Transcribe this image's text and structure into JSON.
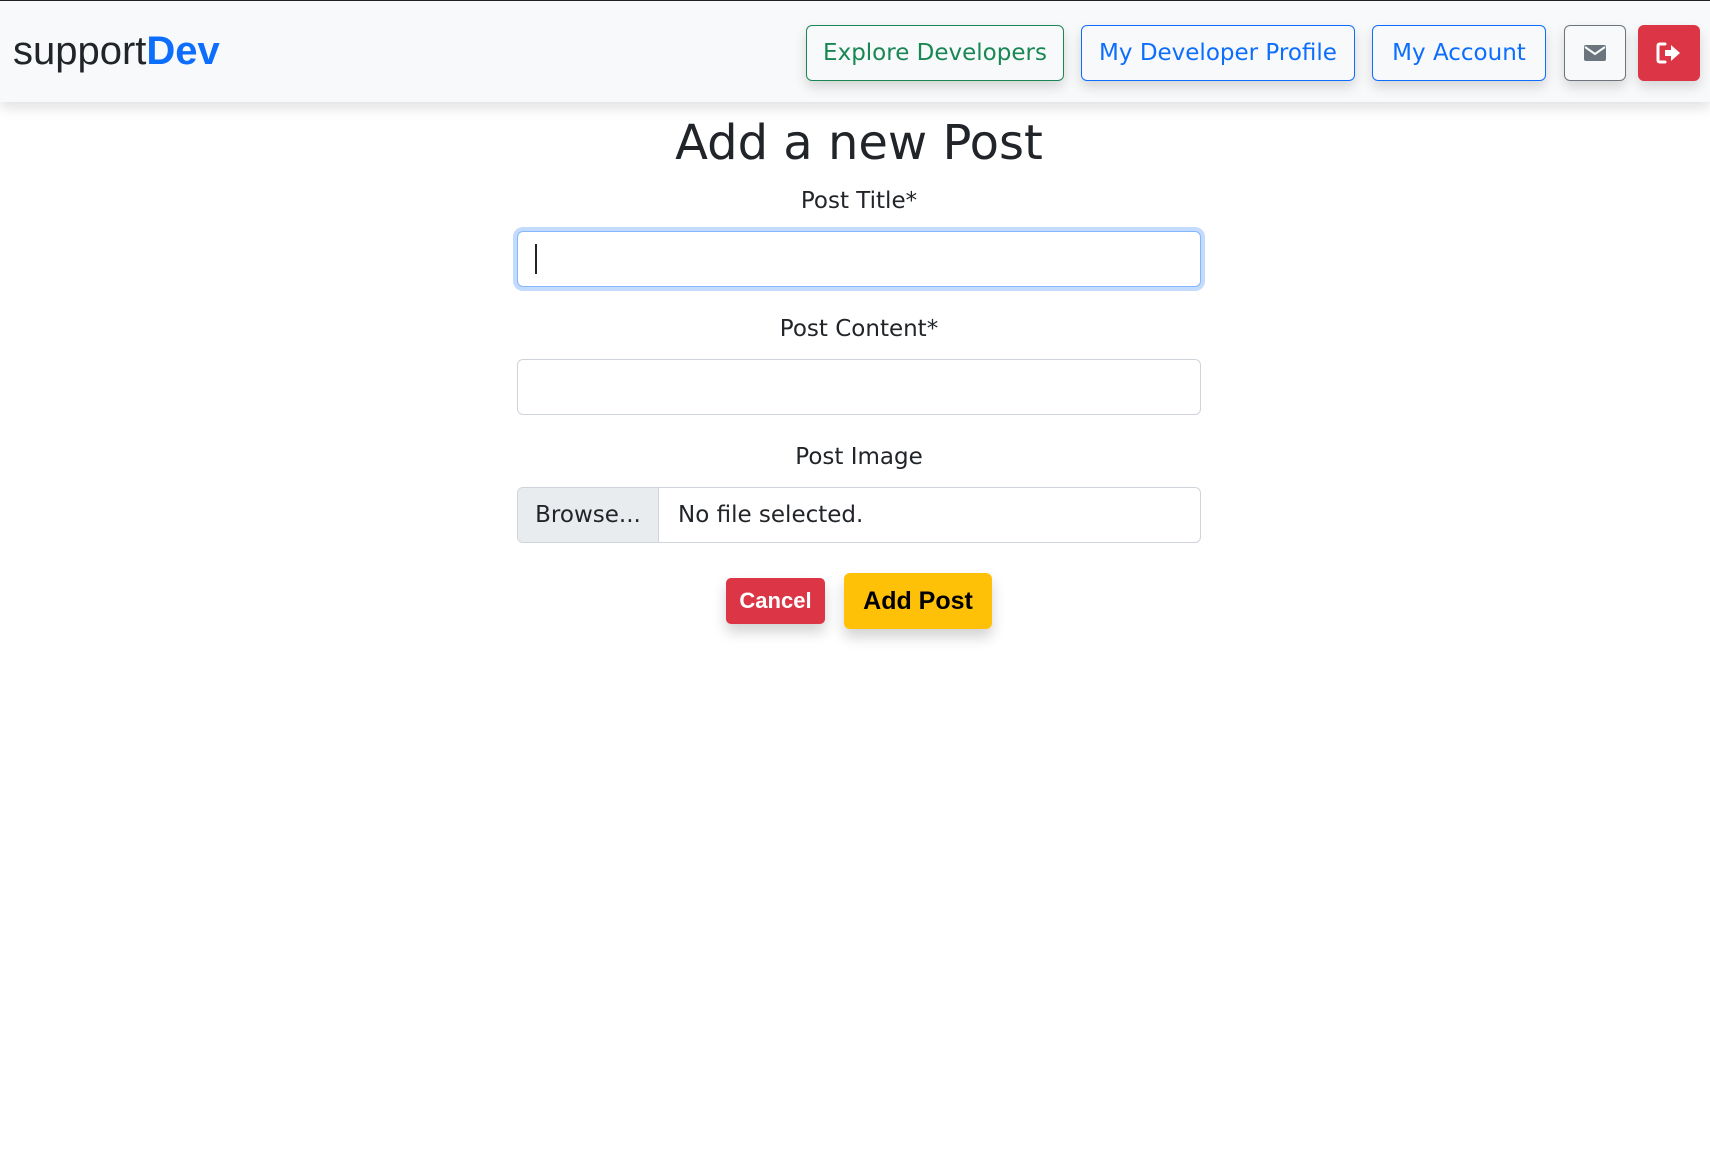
{
  "brand": {
    "prefix": "support",
    "accent": "Dev"
  },
  "nav": {
    "explore_label": "Explore Developers",
    "profile_label": "My Developer Profile",
    "account_label": "My Account",
    "mail_icon": "envelope-icon",
    "logout_icon": "sign-out-icon"
  },
  "form": {
    "heading": "Add a new Post",
    "title_label": "Post Title*",
    "title_value": "",
    "content_label": "Post Content*",
    "content_value": "",
    "image_label": "Post Image",
    "browse_label": "Browse...",
    "file_status": "No file selected.",
    "cancel_label": "Cancel",
    "submit_label": "Add Post"
  },
  "colors": {
    "primary": "#0d6efd",
    "success": "#198754",
    "danger": "#dc3545",
    "warning": "#ffc107",
    "secondary": "#6c757d"
  }
}
